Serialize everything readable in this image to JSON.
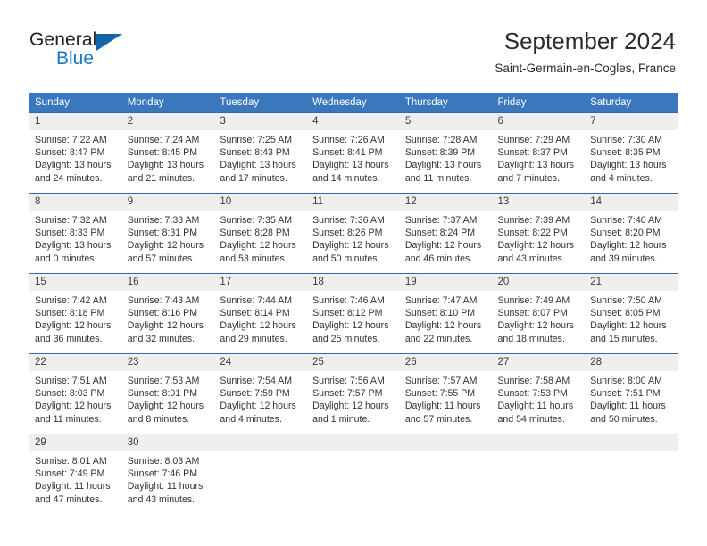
{
  "logo": {
    "line1": "General",
    "line2": "Blue",
    "triangle_color": "#1565a8"
  },
  "header": {
    "title": "September 2024",
    "location": "Saint-Germain-en-Cogles, France"
  },
  "theme": {
    "header_blue": "#3b77bd",
    "row_divider_blue": "#2f6bb0",
    "daynum_bg": "#efefef",
    "logo_blue": "#1778c4"
  },
  "weekday_headers": [
    "Sunday",
    "Monday",
    "Tuesday",
    "Wednesday",
    "Thursday",
    "Friday",
    "Saturday"
  ],
  "weeks": [
    [
      {
        "day": "1",
        "sunrise": "Sunrise: 7:22 AM",
        "sunset": "Sunset: 8:47 PM",
        "daylight1": "Daylight: 13 hours",
        "daylight2": "and 24 minutes."
      },
      {
        "day": "2",
        "sunrise": "Sunrise: 7:24 AM",
        "sunset": "Sunset: 8:45 PM",
        "daylight1": "Daylight: 13 hours",
        "daylight2": "and 21 minutes."
      },
      {
        "day": "3",
        "sunrise": "Sunrise: 7:25 AM",
        "sunset": "Sunset: 8:43 PM",
        "daylight1": "Daylight: 13 hours",
        "daylight2": "and 17 minutes."
      },
      {
        "day": "4",
        "sunrise": "Sunrise: 7:26 AM",
        "sunset": "Sunset: 8:41 PM",
        "daylight1": "Daylight: 13 hours",
        "daylight2": "and 14 minutes."
      },
      {
        "day": "5",
        "sunrise": "Sunrise: 7:28 AM",
        "sunset": "Sunset: 8:39 PM",
        "daylight1": "Daylight: 13 hours",
        "daylight2": "and 11 minutes."
      },
      {
        "day": "6",
        "sunrise": "Sunrise: 7:29 AM",
        "sunset": "Sunset: 8:37 PM",
        "daylight1": "Daylight: 13 hours",
        "daylight2": "and 7 minutes."
      },
      {
        "day": "7",
        "sunrise": "Sunrise: 7:30 AM",
        "sunset": "Sunset: 8:35 PM",
        "daylight1": "Daylight: 13 hours",
        "daylight2": "and 4 minutes."
      }
    ],
    [
      {
        "day": "8",
        "sunrise": "Sunrise: 7:32 AM",
        "sunset": "Sunset: 8:33 PM",
        "daylight1": "Daylight: 13 hours",
        "daylight2": "and 0 minutes."
      },
      {
        "day": "9",
        "sunrise": "Sunrise: 7:33 AM",
        "sunset": "Sunset: 8:31 PM",
        "daylight1": "Daylight: 12 hours",
        "daylight2": "and 57 minutes."
      },
      {
        "day": "10",
        "sunrise": "Sunrise: 7:35 AM",
        "sunset": "Sunset: 8:28 PM",
        "daylight1": "Daylight: 12 hours",
        "daylight2": "and 53 minutes."
      },
      {
        "day": "11",
        "sunrise": "Sunrise: 7:36 AM",
        "sunset": "Sunset: 8:26 PM",
        "daylight1": "Daylight: 12 hours",
        "daylight2": "and 50 minutes."
      },
      {
        "day": "12",
        "sunrise": "Sunrise: 7:37 AM",
        "sunset": "Sunset: 8:24 PM",
        "daylight1": "Daylight: 12 hours",
        "daylight2": "and 46 minutes."
      },
      {
        "day": "13",
        "sunrise": "Sunrise: 7:39 AM",
        "sunset": "Sunset: 8:22 PM",
        "daylight1": "Daylight: 12 hours",
        "daylight2": "and 43 minutes."
      },
      {
        "day": "14",
        "sunrise": "Sunrise: 7:40 AM",
        "sunset": "Sunset: 8:20 PM",
        "daylight1": "Daylight: 12 hours",
        "daylight2": "and 39 minutes."
      }
    ],
    [
      {
        "day": "15",
        "sunrise": "Sunrise: 7:42 AM",
        "sunset": "Sunset: 8:18 PM",
        "daylight1": "Daylight: 12 hours",
        "daylight2": "and 36 minutes."
      },
      {
        "day": "16",
        "sunrise": "Sunrise: 7:43 AM",
        "sunset": "Sunset: 8:16 PM",
        "daylight1": "Daylight: 12 hours",
        "daylight2": "and 32 minutes."
      },
      {
        "day": "17",
        "sunrise": "Sunrise: 7:44 AM",
        "sunset": "Sunset: 8:14 PM",
        "daylight1": "Daylight: 12 hours",
        "daylight2": "and 29 minutes."
      },
      {
        "day": "18",
        "sunrise": "Sunrise: 7:46 AM",
        "sunset": "Sunset: 8:12 PM",
        "daylight1": "Daylight: 12 hours",
        "daylight2": "and 25 minutes."
      },
      {
        "day": "19",
        "sunrise": "Sunrise: 7:47 AM",
        "sunset": "Sunset: 8:10 PM",
        "daylight1": "Daylight: 12 hours",
        "daylight2": "and 22 minutes."
      },
      {
        "day": "20",
        "sunrise": "Sunrise: 7:49 AM",
        "sunset": "Sunset: 8:07 PM",
        "daylight1": "Daylight: 12 hours",
        "daylight2": "and 18 minutes."
      },
      {
        "day": "21",
        "sunrise": "Sunrise: 7:50 AM",
        "sunset": "Sunset: 8:05 PM",
        "daylight1": "Daylight: 12 hours",
        "daylight2": "and 15 minutes."
      }
    ],
    [
      {
        "day": "22",
        "sunrise": "Sunrise: 7:51 AM",
        "sunset": "Sunset: 8:03 PM",
        "daylight1": "Daylight: 12 hours",
        "daylight2": "and 11 minutes."
      },
      {
        "day": "23",
        "sunrise": "Sunrise: 7:53 AM",
        "sunset": "Sunset: 8:01 PM",
        "daylight1": "Daylight: 12 hours",
        "daylight2": "and 8 minutes."
      },
      {
        "day": "24",
        "sunrise": "Sunrise: 7:54 AM",
        "sunset": "Sunset: 7:59 PM",
        "daylight1": "Daylight: 12 hours",
        "daylight2": "and 4 minutes."
      },
      {
        "day": "25",
        "sunrise": "Sunrise: 7:56 AM",
        "sunset": "Sunset: 7:57 PM",
        "daylight1": "Daylight: 12 hours",
        "daylight2": "and 1 minute."
      },
      {
        "day": "26",
        "sunrise": "Sunrise: 7:57 AM",
        "sunset": "Sunset: 7:55 PM",
        "daylight1": "Daylight: 11 hours",
        "daylight2": "and 57 minutes."
      },
      {
        "day": "27",
        "sunrise": "Sunrise: 7:58 AM",
        "sunset": "Sunset: 7:53 PM",
        "daylight1": "Daylight: 11 hours",
        "daylight2": "and 54 minutes."
      },
      {
        "day": "28",
        "sunrise": "Sunrise: 8:00 AM",
        "sunset": "Sunset: 7:51 PM",
        "daylight1": "Daylight: 11 hours",
        "daylight2": "and 50 minutes."
      }
    ],
    [
      {
        "day": "29",
        "sunrise": "Sunrise: 8:01 AM",
        "sunset": "Sunset: 7:49 PM",
        "daylight1": "Daylight: 11 hours",
        "daylight2": "and 47 minutes."
      },
      {
        "day": "30",
        "sunrise": "Sunrise: 8:03 AM",
        "sunset": "Sunset: 7:46 PM",
        "daylight1": "Daylight: 11 hours",
        "daylight2": "and 43 minutes."
      },
      {
        "day": "",
        "sunrise": "",
        "sunset": "",
        "daylight1": "",
        "daylight2": ""
      },
      {
        "day": "",
        "sunrise": "",
        "sunset": "",
        "daylight1": "",
        "daylight2": ""
      },
      {
        "day": "",
        "sunrise": "",
        "sunset": "",
        "daylight1": "",
        "daylight2": ""
      },
      {
        "day": "",
        "sunrise": "",
        "sunset": "",
        "daylight1": "",
        "daylight2": ""
      },
      {
        "day": "",
        "sunrise": "",
        "sunset": "",
        "daylight1": "",
        "daylight2": ""
      }
    ]
  ]
}
